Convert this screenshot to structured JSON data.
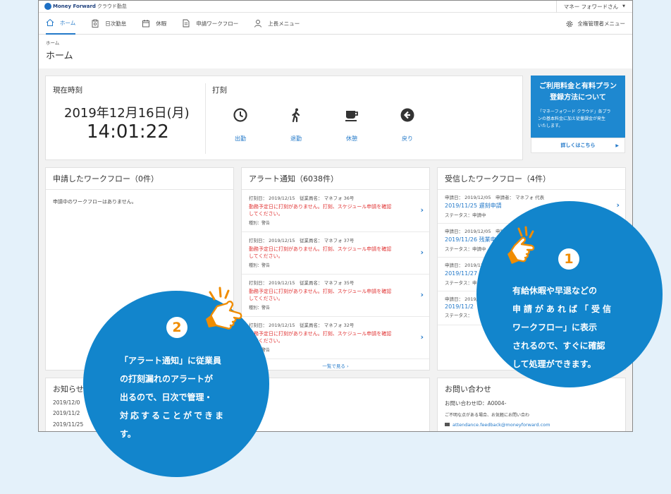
{
  "app": {
    "logo_text": "Money Forward",
    "logo_sub": "クラウド勤怠",
    "user_name": "マネー フォワードさん"
  },
  "nav": {
    "items": [
      {
        "label": "ホーム",
        "icon": "home-icon"
      },
      {
        "label": "日次勤怠",
        "icon": "clipboard-icon"
      },
      {
        "label": "休暇",
        "icon": "calendar-icon"
      },
      {
        "label": "申請ワークフロー",
        "icon": "document-icon"
      },
      {
        "label": "上長メニュー",
        "icon": "user-icon"
      }
    ],
    "admin_label": "全権管理者メニュー"
  },
  "breadcrumb": "ホーム",
  "page_title": "ホーム",
  "time_card": {
    "clock_label": "現在時刻",
    "date": "2019年12月16日(月)",
    "time": "14:01:22",
    "stamp_label": "打刻",
    "buttons": [
      {
        "label": "出勤",
        "icon": "clock-icon"
      },
      {
        "label": "退勤",
        "icon": "walking-icon"
      },
      {
        "label": "休憩",
        "icon": "coffee-icon"
      },
      {
        "label": "戻り",
        "icon": "back-arrow-icon"
      }
    ]
  },
  "promo": {
    "title_line1": "ご利用料金と有料プラン",
    "title_line2": "登録方法について",
    "body_line1": "「マネーフォワード クラウド」各プラ",
    "body_line2": "ンの基本料金に加え従量課金が発生",
    "body_line3": "いたします。",
    "more": "詳しくはこちら"
  },
  "my_workflow": {
    "title": "申請したワークフロー（0件）",
    "empty": "申請中のワークフローはありません。"
  },
  "alerts": {
    "title": "アラート通知（6038件）",
    "items": [
      {
        "meta": "打刻日： 2019/12/15　従業員名： マネフォ 36号",
        "msg1": "勤務予定日に打刻がありません。打刻、スケジュール申請を確認",
        "msg2": "してください。",
        "kind": "種別：警告"
      },
      {
        "meta": "打刻日： 2019/12/15　従業員名： マネフォ 37号",
        "msg1": "勤務予定日に打刻がありません。打刻、スケジュール申請を確認",
        "msg2": "してください。",
        "kind": "種別：警告"
      },
      {
        "meta": "打刻日： 2019/12/15　従業員名： マネフォ 35号",
        "msg1": "勤務予定日に打刻がありません。打刻、スケジュール申請を確認",
        "msg2": "してください。",
        "kind": "種別：警告"
      },
      {
        "meta": "打刻日： 2019/12/15　従業員名： マネフォ 32号",
        "msg1": "勤務予定日に打刻がありません。打刻、スケジュール申請を確認",
        "msg2": "してください。",
        "kind": "種別：警告"
      }
    ],
    "more": "一覧で見る"
  },
  "received": {
    "title": "受信したワークフロー（4件）",
    "items": [
      {
        "meta": "申請日： 2019/12/05　申請者： マネフォ 代表",
        "link": "2019/11/25 遅刻申請",
        "status": "ステータス：申請中"
      },
      {
        "meta": "申請日： 2019/12/05　申請者： マネフォ 代表",
        "link": "2019/11/26 残業申請",
        "status": "ステータス：申請中"
      },
      {
        "meta": "申請日： 2019/12/05",
        "link": "2019/11/27 欠勤",
        "status": "ステータス：申"
      },
      {
        "meta": "申請日： 2019/",
        "link": "2019/11/2",
        "status": "ステータス："
      }
    ]
  },
  "news": {
    "title": "お知らせ",
    "rows": [
      {
        "date": "2019/12/0",
        "text": ""
      },
      {
        "date": "2019/11/2",
        "text": ""
      },
      {
        "date": "2019/11/25",
        "text": "た"
      }
    ]
  },
  "inquiry": {
    "title": "お問い合わせ",
    "id": "お問い合わせID：A0004-",
    "note": "ご不明な点がある場合、お気軽にお問い合わ",
    "email": "attendance.feedback@moneyforward.com"
  },
  "callouts": {
    "one": {
      "number": "1",
      "lines": [
        "有給休暇や早退などの",
        "申請があれば「受信",
        "ワークフロー」に表示",
        "されるので、すぐに確認",
        "して処理ができます。"
      ]
    },
    "two": {
      "number": "2",
      "lines": [
        "「アラート通知」に従業員",
        "の打刻漏れのアラートが",
        "出るので、日次で管理・",
        "対応することができま",
        "す。"
      ]
    }
  },
  "colors": {
    "accent": "#2379c9",
    "bubble": "#1285cc",
    "alert_red": "#e03232",
    "number_orange": "#f08c00",
    "background": "#e4f1fa"
  }
}
